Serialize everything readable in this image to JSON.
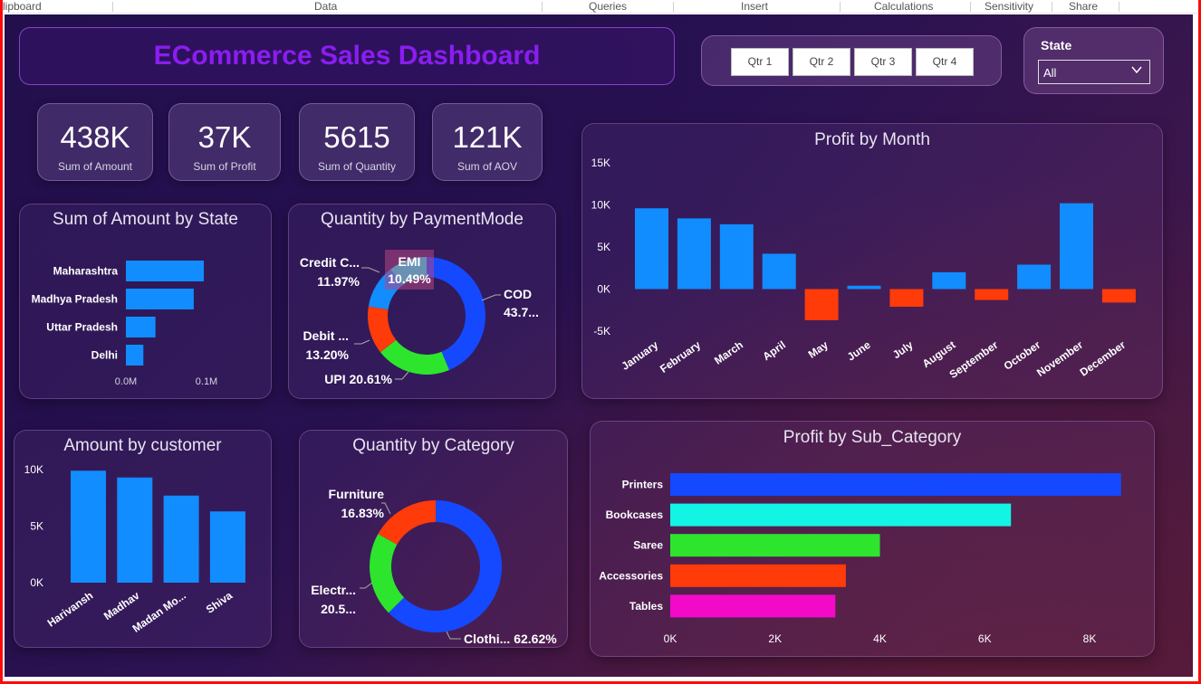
{
  "ribbon": [
    "lipboard",
    "Data",
    "Queries",
    "Insert",
    "Calculations",
    "Sensitivity",
    "Share"
  ],
  "title": "ECommerce Sales Dashboard",
  "quarters": [
    "Qtr 1",
    "Qtr 2",
    "Qtr 3",
    "Qtr 4"
  ],
  "state_filter": {
    "label": "State",
    "value": "All"
  },
  "kpis": [
    {
      "value": "438K",
      "label": "Sum of Amount"
    },
    {
      "value": "37K",
      "label": "Sum of Profit"
    },
    {
      "value": "5615",
      "label": "Sum of Quantity"
    },
    {
      "value": "121K",
      "label": "Sum of AOV"
    }
  ],
  "colors": {
    "bar": "#118dff",
    "negative": "#ff3b0a",
    "cod": "#1449ff",
    "upi": "#2de52d",
    "debit": "#ff3b0a",
    "credit": "#118dff",
    "emi": "#12eded",
    "clothing": "#1449ff",
    "electronics": "#2de52d",
    "furniture": "#ff3b0a",
    "printers": "#1449ff",
    "bookcases": "#12f5e5",
    "saree": "#2de52d",
    "accessories": "#ff3b0a",
    "tables": "#f20ac8"
  },
  "chart_data": [
    {
      "id": "state",
      "type": "bar",
      "orientation": "horizontal",
      "title": "Sum of Amount by State",
      "categories": [
        "Maharashtra",
        "Madhya Pradesh",
        "Uttar Pradesh",
        "Delhi"
      ],
      "values": [
        0.116,
        0.101,
        0.044,
        0.026
      ],
      "xticks": [
        "0.0M",
        "0.1M"
      ],
      "xlim": [
        0,
        0.12
      ]
    },
    {
      "id": "payment",
      "type": "pie",
      "title": "Quantity by PaymentMode",
      "categories": [
        "COD",
        "UPI",
        "Debit Card",
        "Credit Card",
        "EMI"
      ],
      "values": [
        43.73,
        20.61,
        13.2,
        11.97,
        10.49
      ],
      "labels": [
        {
          "name": "COD",
          "pct": "43.7..."
        },
        {
          "name": "UPI",
          "pct": "20.61%"
        },
        {
          "name": "Debit ...",
          "pct": "13.20%"
        },
        {
          "name": "Credit C...",
          "pct": "11.97%"
        },
        {
          "name": "EMI",
          "pct": "10.49%"
        }
      ]
    },
    {
      "id": "month",
      "type": "bar",
      "title": "Profit by Month",
      "categories": [
        "January",
        "February",
        "March",
        "April",
        "May",
        "June",
        "July",
        "August",
        "September",
        "October",
        "November",
        "December"
      ],
      "values": [
        9600,
        8400,
        7700,
        4200,
        -3700,
        400,
        -2100,
        2000,
        -1300,
        2900,
        10200,
        -1600
      ],
      "yticks": [
        "15K",
        "10K",
        "5K",
        "0K",
        "-5K"
      ],
      "ylim": [
        -5000,
        15000
      ]
    },
    {
      "id": "customer",
      "type": "bar",
      "title": "Amount by customer",
      "categories": [
        "Harivansh",
        "Madhav",
        "Madan Mo...",
        "Shiva"
      ],
      "values": [
        9900,
        9300,
        7700,
        6300
      ],
      "yticks": [
        "10K",
        "5K",
        "0K"
      ],
      "ylim": [
        0,
        10000
      ]
    },
    {
      "id": "category",
      "type": "pie",
      "title": "Quantity by Category",
      "categories": [
        "Clothing",
        "Electronics",
        "Furniture"
      ],
      "values": [
        62.62,
        20.55,
        16.83
      ],
      "labels": [
        {
          "name": "Clothi...",
          "pct": "62.62%"
        },
        {
          "name": "Electr...",
          "pct": "20.5..."
        },
        {
          "name": "Furniture",
          "pct": "16.83%"
        }
      ]
    },
    {
      "id": "subcat",
      "type": "bar",
      "orientation": "horizontal",
      "title": "Profit by Sub_Category",
      "categories": [
        "Printers",
        "Bookcases",
        "Saree",
        "Accessories",
        "Tables"
      ],
      "values": [
        8600,
        6500,
        4000,
        3350,
        3150
      ],
      "xticks": [
        "0K",
        "2K",
        "4K",
        "6K",
        "8K"
      ],
      "xlim": [
        0,
        8000
      ]
    }
  ]
}
